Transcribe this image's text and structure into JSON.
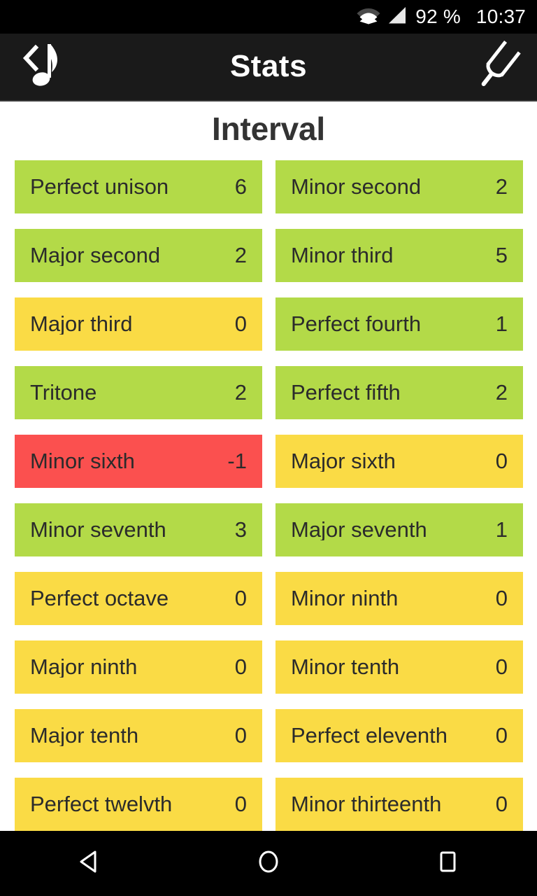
{
  "status_bar": {
    "wifi_icon": "wifi-icon",
    "signal_icon": "signal-icon",
    "battery": "92 %",
    "time": "10:37"
  },
  "app_bar": {
    "back_icon": "back-music-note-icon",
    "title": "Stats",
    "tuner_icon": "tuning-fork-icon"
  },
  "main": {
    "section_title": "Interval",
    "colors": {
      "green": "#b3da48",
      "yellow": "#fadb45",
      "red": "#fb504f",
      "text": "#2b2b2b",
      "background": "#ffffff"
    },
    "items": [
      {
        "label": "Perfect unison",
        "value": "6",
        "color": "#b3da48"
      },
      {
        "label": "Minor second",
        "value": "2",
        "color": "#b3da48"
      },
      {
        "label": "Major second",
        "value": "2",
        "color": "#b3da48"
      },
      {
        "label": "Minor third",
        "value": "5",
        "color": "#b3da48"
      },
      {
        "label": "Major third",
        "value": "0",
        "color": "#fadb45"
      },
      {
        "label": "Perfect fourth",
        "value": "1",
        "color": "#b3da48"
      },
      {
        "label": "Tritone",
        "value": "2",
        "color": "#b3da48"
      },
      {
        "label": "Perfect fifth",
        "value": "2",
        "color": "#b3da48"
      },
      {
        "label": "Minor sixth",
        "value": "-1",
        "color": "#fb504f"
      },
      {
        "label": "Major sixth",
        "value": "0",
        "color": "#fadb45"
      },
      {
        "label": "Minor seventh",
        "value": "3",
        "color": "#b3da48"
      },
      {
        "label": "Major seventh",
        "value": "1",
        "color": "#b3da48"
      },
      {
        "label": "Perfect octave",
        "value": "0",
        "color": "#fadb45"
      },
      {
        "label": "Minor ninth",
        "value": "0",
        "color": "#fadb45"
      },
      {
        "label": "Major ninth",
        "value": "0",
        "color": "#fadb45"
      },
      {
        "label": "Minor tenth",
        "value": "0",
        "color": "#fadb45"
      },
      {
        "label": "Major tenth",
        "value": "0",
        "color": "#fadb45"
      },
      {
        "label": "Perfect eleventh",
        "value": "0",
        "color": "#fadb45"
      },
      {
        "label": "Perfect twelvth",
        "value": "0",
        "color": "#fadb45"
      },
      {
        "label": "Minor thirteenth",
        "value": "0",
        "color": "#fadb45"
      }
    ]
  },
  "nav_bar": {
    "back_icon": "nav-back-triangle-icon",
    "home_icon": "nav-home-circle-icon",
    "recents_icon": "nav-recents-square-icon"
  }
}
